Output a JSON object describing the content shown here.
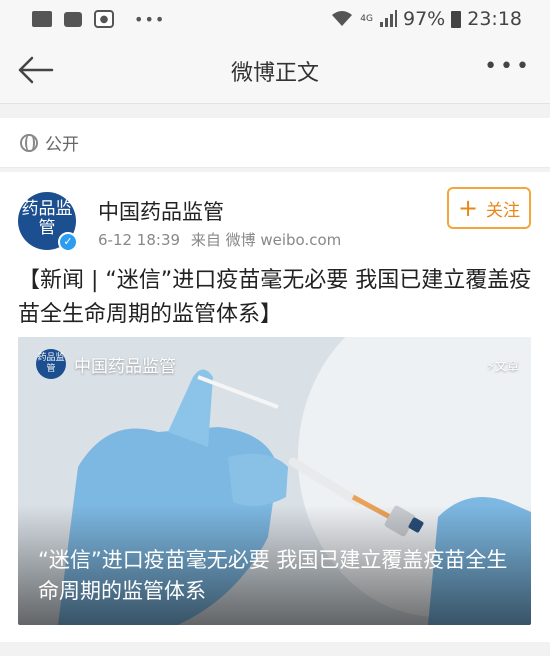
{
  "status_bar": {
    "battery": "97%",
    "time": "23:18",
    "network": "4G",
    "more": "•••"
  },
  "nav": {
    "title": "微博正文",
    "more": "•••"
  },
  "visibility": {
    "label": "公开"
  },
  "post": {
    "author": "中国药品监管",
    "avatar_text": "药品监管",
    "date": "6-12 18:39",
    "source": "来自 微博 weibo.com",
    "follow_label": "关注",
    "text": "【新闻 | “迷信”进口疫苗毫无必要 我国已建立覆盖疫苗全生命周期的监管体系】",
    "card": {
      "source_name": "中国药品监管",
      "tag": "文章",
      "title": "“迷信”进口疫苗毫无必要 我国已建立覆盖疫苗全生命周期的监管体系"
    }
  },
  "colors": {
    "accent_follow": "#f3a63b",
    "avatar_bg": "#1c4f8f",
    "verified": "#2b9cf0"
  }
}
